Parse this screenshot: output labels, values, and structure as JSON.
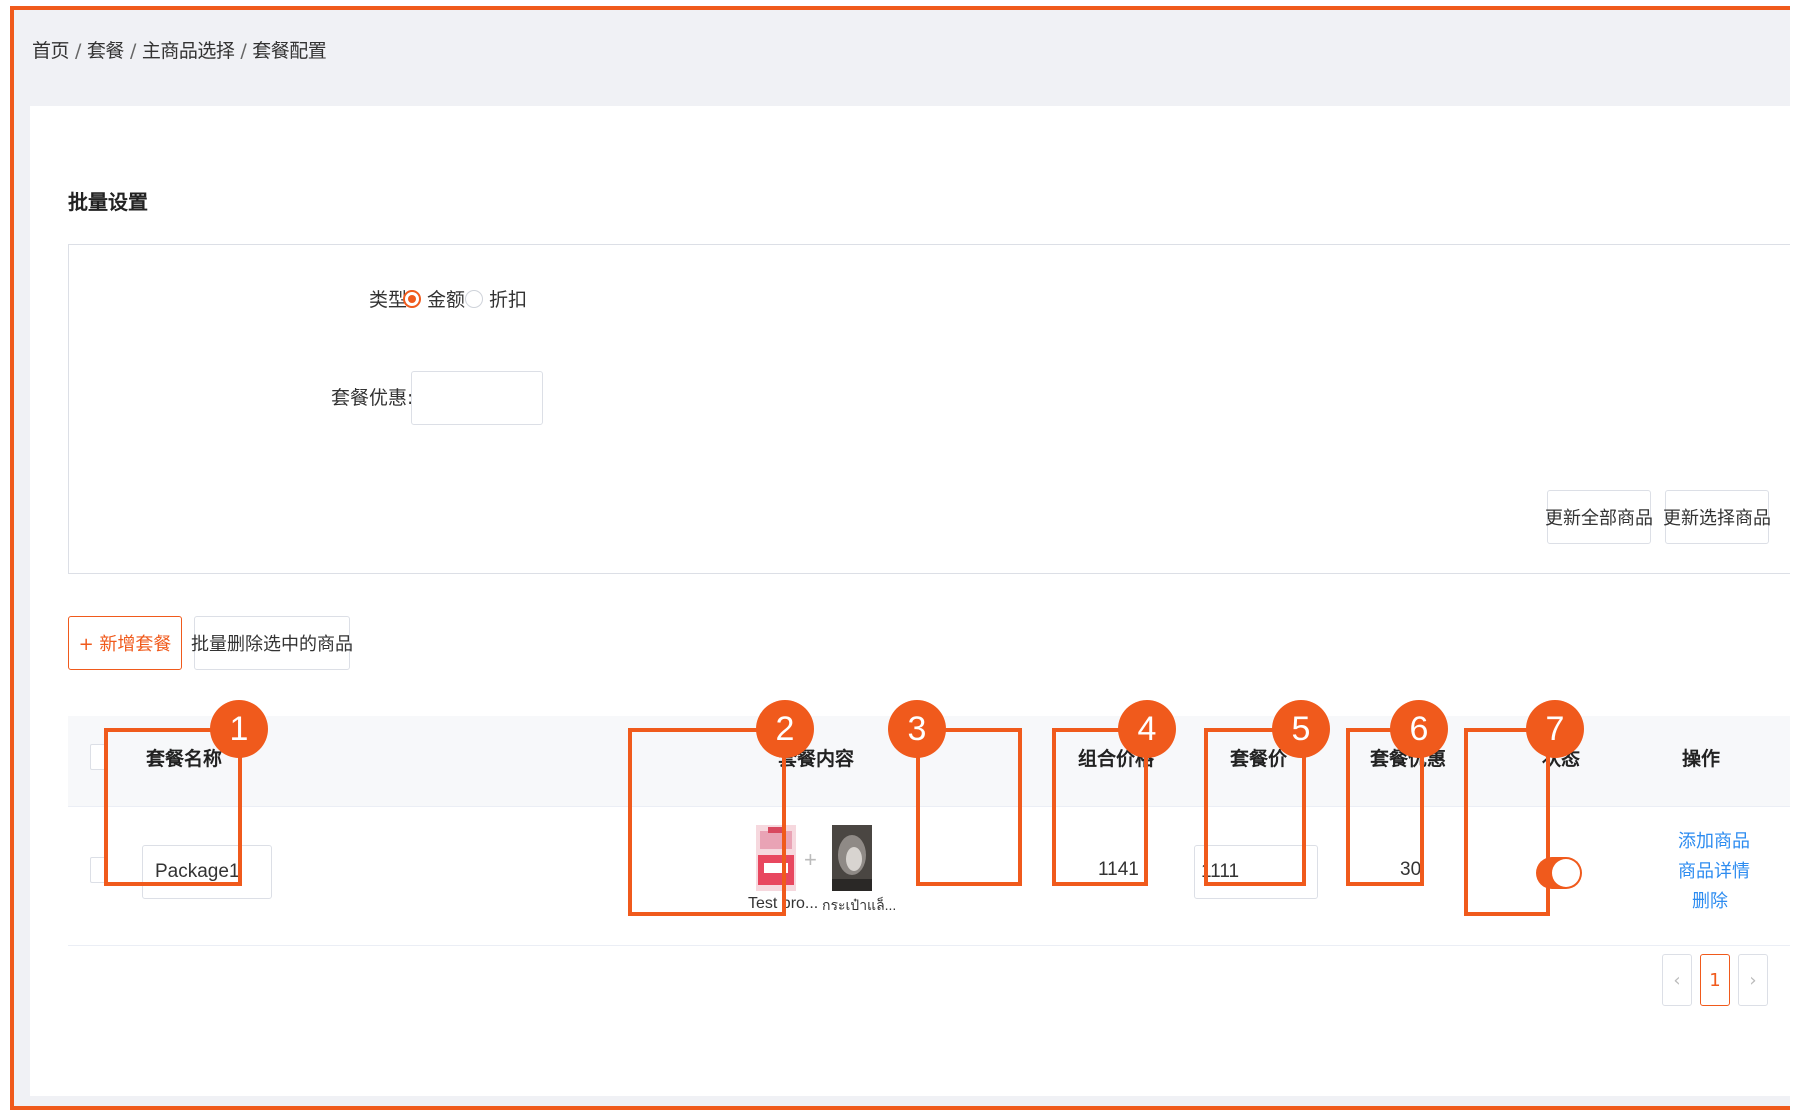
{
  "breadcrumb": [
    "首页",
    "套餐",
    "主商品选择",
    "套餐配置"
  ],
  "batch_settings": {
    "title": "批量设置",
    "type_label": "类型:",
    "type_options": [
      "金额",
      "折扣"
    ],
    "type_selected": "金额",
    "discount_label": "套餐优惠:",
    "discount_value": "",
    "update_all_button": "更新全部商品",
    "update_selected_button": "更新选择商品"
  },
  "toolbar": {
    "add_button": "+ 新增套餐",
    "batch_delete_button": "批量删除选中的商品"
  },
  "table": {
    "columns": [
      "套餐名称",
      "套餐内容",
      "组合价格",
      "套餐价",
      "套餐优惠",
      "状态",
      "操作"
    ],
    "rows": [
      {
        "name": "Package1",
        "content_items": [
          "Test pro...",
          "กระเป๋าแล็..."
        ],
        "content_plus": "+",
        "combo_price": "1141",
        "package_price": "1111",
        "discount": "30",
        "status_on": true,
        "actions": [
          "添加商品",
          "商品详情",
          "删除"
        ]
      }
    ]
  },
  "pagination": {
    "prev": "‹",
    "current": "1",
    "next": "›"
  },
  "callouts": [
    "1",
    "2",
    "3",
    "4",
    "5",
    "6",
    "7"
  ],
  "colors": {
    "accent": "#f05a1c",
    "link": "#2d8cf0"
  }
}
